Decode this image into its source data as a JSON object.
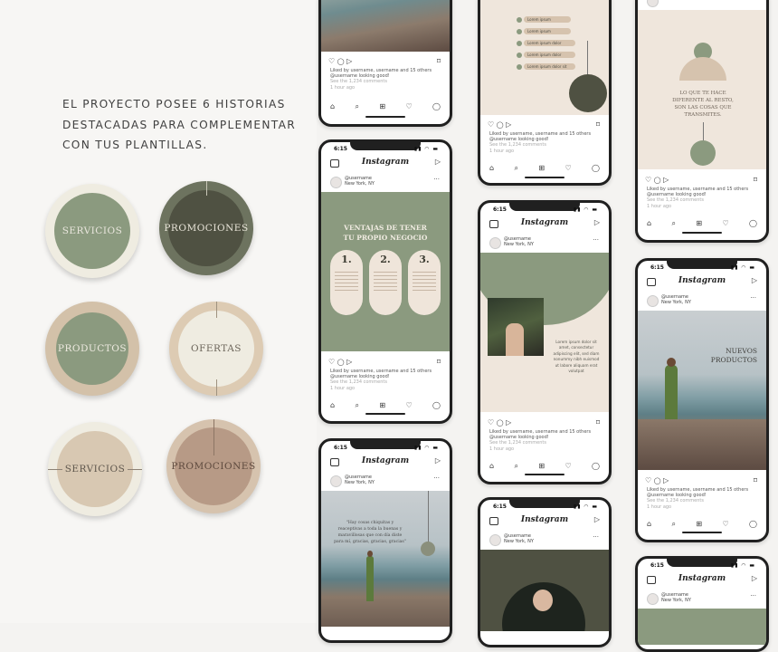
{
  "intro": {
    "lines": [
      "EL PROYECTO POSEE 6 HISTORIAS",
      "DESTACADAS PARA COMPLEMENTAR",
      "CON TUS PLANTILLAS."
    ]
  },
  "highlights": [
    {
      "label": "SERVICIOS"
    },
    {
      "label": "PROMOCIONES"
    },
    {
      "label": "PRODUCTOS"
    },
    {
      "label": "OFERTAS"
    },
    {
      "label": "SERVICIOS"
    },
    {
      "label": "PROMOCIONES"
    }
  ],
  "colors": {
    "sage": "#8b9a7f",
    "olive_dark": "#4f5142",
    "beige": "#d8c8b2",
    "cream": "#efece1",
    "terracotta": "#b79a86"
  },
  "ig": {
    "time": "6:15",
    "logo": "Instagram",
    "username": "@username",
    "location": "New York, NY",
    "likes": "Liked by username, username and 15 others @username looking good!",
    "comments": "See the 1,234 comments",
    "ago": "1 hour ago"
  },
  "p2": {
    "title1": "VENTAJAS DE TENER",
    "title2": "TU PROPIO NEGOCIO",
    "n1": "1.",
    "n2": "2.",
    "n3": "3."
  },
  "p3": {
    "quote": "\"Hay cosas chiquitas y reaceptivas a toda la buenas y maravillosas que con día diste para mí, gracias, gracias, gracias\""
  },
  "p4": {
    "items": [
      "Lorem ipsum",
      "Lorem ipsum",
      "Lorem ipsum dolor",
      "Lorem ipsum dolor",
      "Lorem ipsum dolor sit"
    ]
  },
  "p5": {
    "body": "Lorem ipsum dolor sit amet, consectetur adipiscing elit, sed diam nonummy nibh euismod ut labore aliquam erat volutpat"
  },
  "p7": {
    "text": "LO QUE TE HACE DIFERENTE AL RESTO, SON LAS COSAS QUE TRANSMITES."
  },
  "p8": {
    "title1": "NUEVOS",
    "title2": "PRODUCTOS"
  },
  "icons": {
    "heart": "♡",
    "comment": "◯",
    "send": "▷",
    "save": "⌑",
    "home": "⌂",
    "search": "⌕",
    "add": "⊞",
    "profile": "◯"
  }
}
